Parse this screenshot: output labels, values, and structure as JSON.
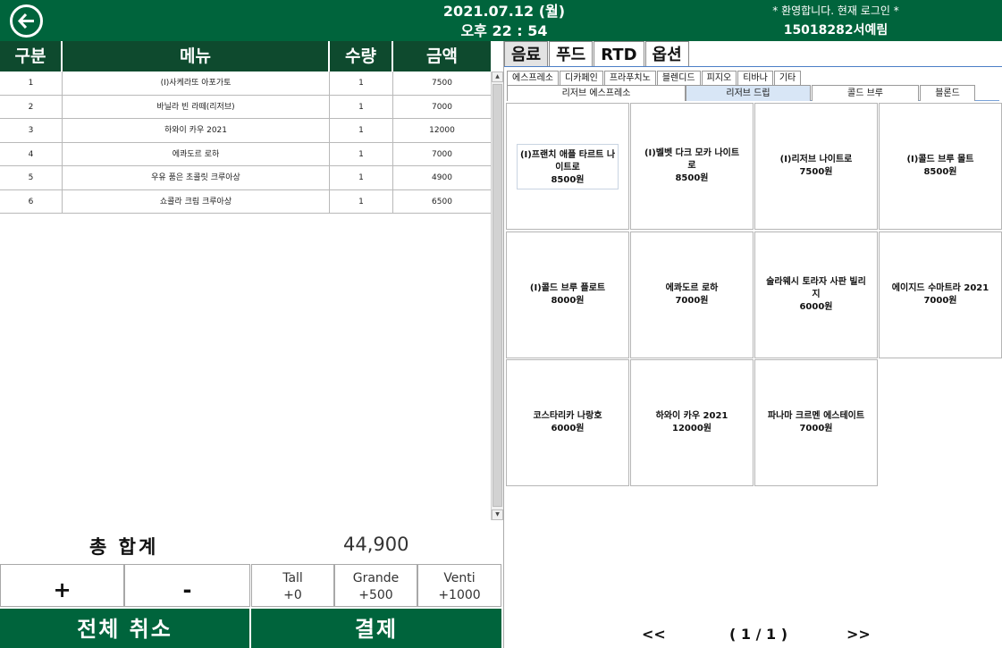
{
  "header": {
    "date": "2021.07.12 (월)",
    "time": "오후 22 : 54",
    "welcome": "* 환영합니다. 현재 로그인 *",
    "user": "15018282서예림"
  },
  "order": {
    "columns": [
      "구분",
      "메뉴",
      "수량",
      "금액"
    ],
    "rows": [
      {
        "no": "1",
        "menu": "(I)사케라또 아포가토",
        "qty": "1",
        "price": "7500"
      },
      {
        "no": "2",
        "menu": "바닐라 빈 라떼(리저브)",
        "qty": "1",
        "price": "7000"
      },
      {
        "no": "3",
        "menu": "하와이 카우 2021",
        "qty": "1",
        "price": "12000"
      },
      {
        "no": "4",
        "menu": "에콰도르 로하",
        "qty": "1",
        "price": "7000"
      },
      {
        "no": "5",
        "menu": "우유 품은 초콜릿 크루아상",
        "qty": "1",
        "price": "4900"
      },
      {
        "no": "6",
        "menu": "쇼콜라 크림 크루아상",
        "qty": "1",
        "price": "6500"
      }
    ]
  },
  "total": {
    "label": "총 합계",
    "value": "44,900"
  },
  "qty_controls": {
    "plus": "+",
    "minus": "-"
  },
  "sizes": [
    {
      "name": "Tall",
      "price": "+0"
    },
    {
      "name": "Grande",
      "price": "+500"
    },
    {
      "name": "Venti",
      "price": "+1000"
    }
  ],
  "actions": {
    "cancel_all": "전체 취소",
    "pay": "결제"
  },
  "categories": [
    "음료",
    "푸드",
    "RTD",
    "옵션"
  ],
  "active_category": "음료",
  "subcategories": [
    "에스프레소",
    "디카페인",
    "프라푸치노",
    "블렌디드",
    "피지오",
    "티바나",
    "기타"
  ],
  "subcategories2": [
    "리저브 에스프레소",
    "리저브 드립",
    "콜드 브루",
    "블론드"
  ],
  "active_subcategory2": "리저브 드립",
  "menu_items": [
    {
      "name": "(I)프랜치 애플 타르트 나이트로",
      "price": "8500원"
    },
    {
      "name": "(I)벨벳 다크 모카 나이트로",
      "price": "8500원"
    },
    {
      "name": "(I)리저브 나이트로",
      "price": "7500원"
    },
    {
      "name": "(I)콜드 브루 몰트",
      "price": "8500원"
    },
    {
      "name": "(I)콜드 브루 플로트",
      "price": "8000원"
    },
    {
      "name": "에콰도르 로하",
      "price": "7000원"
    },
    {
      "name": "술라웨시 토라자 사판 빌리지",
      "price": "6000원"
    },
    {
      "name": "에이지드 수마트라 2021",
      "price": "7000원"
    },
    {
      "name": "코스타리카 나랑호",
      "price": "6000원"
    },
    {
      "name": "하와이 카우 2021",
      "price": "12000원"
    },
    {
      "name": "파나마 크르멘 에스테이트",
      "price": "7000원"
    }
  ],
  "pager": {
    "prev": "<<",
    "page": "( 1 / 1 )",
    "next": ">>"
  }
}
